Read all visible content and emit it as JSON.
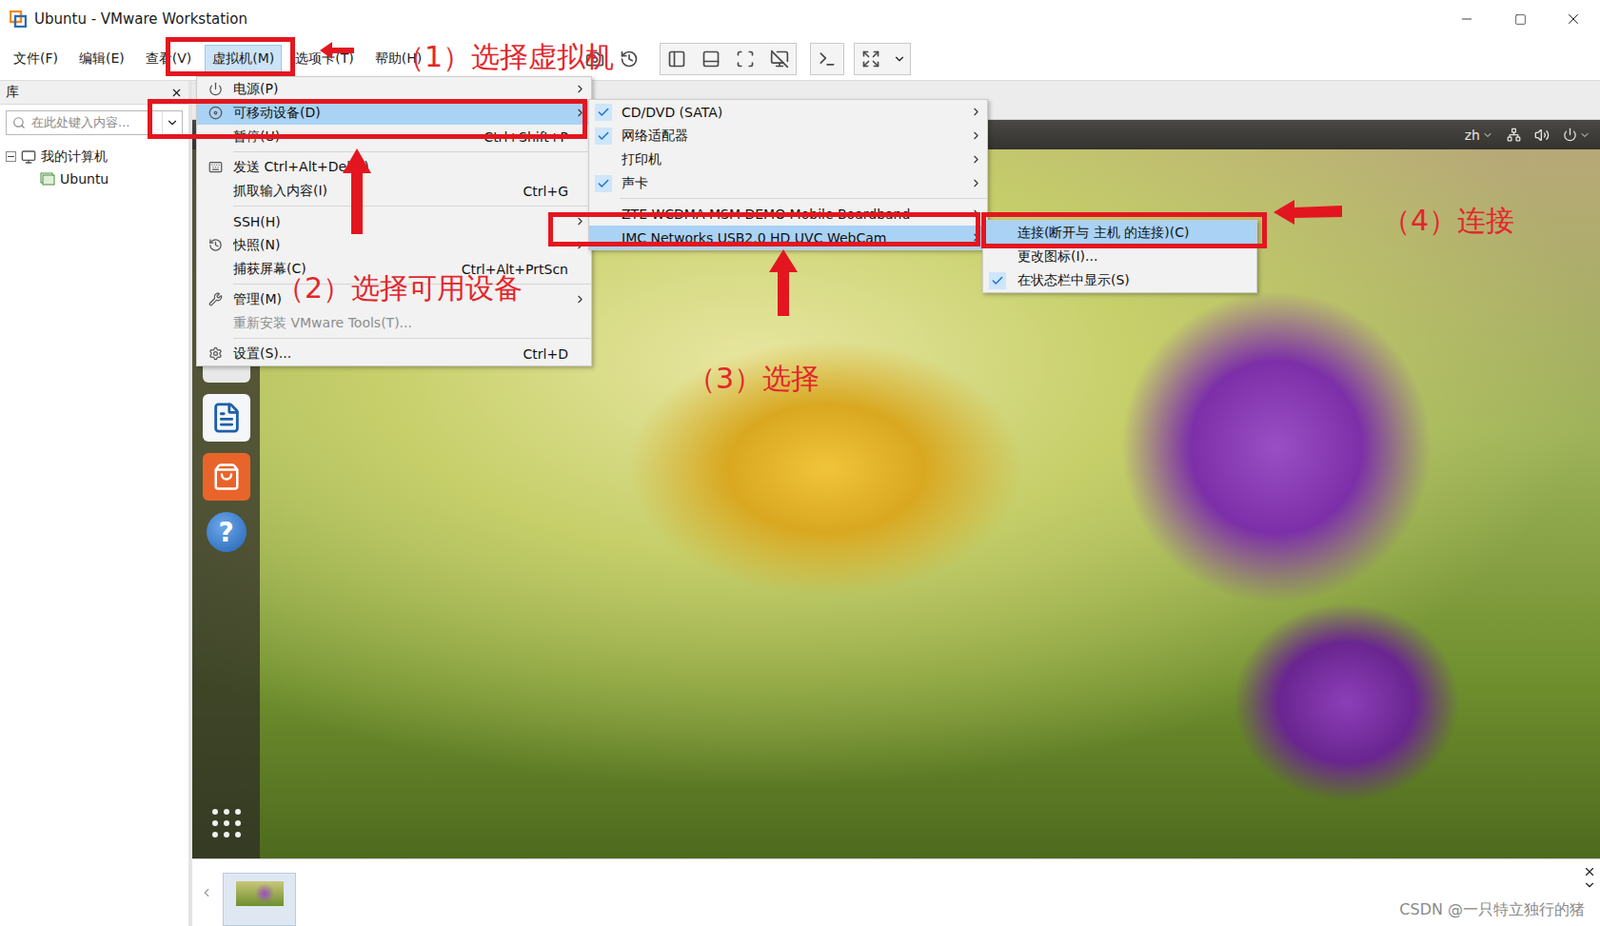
{
  "window": {
    "title": "Ubuntu - VMware Workstation"
  },
  "menubar": [
    {
      "label": "文件(F)",
      "selected": false
    },
    {
      "label": "编辑(E)",
      "selected": false
    },
    {
      "label": "查看(V)",
      "selected": false
    },
    {
      "label": "虚拟机(M)",
      "selected": true
    },
    {
      "label": "选项卡(T)",
      "selected": false
    },
    {
      "label": "帮助(H)",
      "selected": false
    }
  ],
  "library": {
    "title": "库",
    "search_placeholder": "在此处键入内容...",
    "tree": [
      {
        "label": "我的计算机",
        "level": 0,
        "expanded": true,
        "selected": false
      },
      {
        "label": "Ubuntu",
        "level": 1,
        "expanded": false,
        "selected": false
      }
    ]
  },
  "guest_panel": {
    "language": "zh"
  },
  "launcher": {
    "help_label": "?"
  },
  "vm_menu": [
    {
      "label": "电源(P)",
      "shortcut": "",
      "submenu": true,
      "selected": false,
      "disabled": false,
      "separator_before": false
    },
    {
      "label": "可移动设备(D)",
      "shortcut": "",
      "submenu": true,
      "selected": true,
      "disabled": false,
      "separator_before": false
    },
    {
      "label": "暂停(U)",
      "shortcut": "Ctrl+Shift+P",
      "submenu": false,
      "selected": false,
      "disabled": false,
      "separator_before": false
    },
    {
      "label": "发送 Ctrl+Alt+Del(E)",
      "shortcut": "",
      "submenu": false,
      "selected": false,
      "disabled": false,
      "separator_before": true
    },
    {
      "label": "抓取输入内容(I)",
      "shortcut": "Ctrl+G",
      "submenu": false,
      "selected": false,
      "disabled": false,
      "separator_before": false
    },
    {
      "label": "SSH(H)",
      "shortcut": "",
      "submenu": true,
      "selected": false,
      "disabled": false,
      "separator_before": true
    },
    {
      "label": "快照(N)",
      "shortcut": "",
      "submenu": true,
      "selected": false,
      "disabled": false,
      "separator_before": false
    },
    {
      "label": "捕获屏幕(C)",
      "shortcut": "Ctrl+Alt+PrtScn",
      "submenu": false,
      "selected": false,
      "disabled": false,
      "separator_before": false
    },
    {
      "label": "管理(M)",
      "shortcut": "",
      "submenu": true,
      "selected": false,
      "disabled": false,
      "separator_before": true
    },
    {
      "label": "重新安装 VMware Tools(T)...",
      "shortcut": "",
      "submenu": false,
      "selected": false,
      "disabled": true,
      "separator_before": false
    },
    {
      "label": "设置(S)...",
      "shortcut": "Ctrl+D",
      "submenu": false,
      "selected": false,
      "disabled": false,
      "separator_before": true
    }
  ],
  "removable_menu": [
    {
      "label": "CD/DVD (SATA)",
      "checked": true,
      "selected": false,
      "submenu": true,
      "separator_before": false
    },
    {
      "label": "网络适配器",
      "checked": true,
      "selected": false,
      "submenu": true,
      "separator_before": false
    },
    {
      "label": "打印机",
      "checked": false,
      "selected": false,
      "submenu": true,
      "separator_before": false
    },
    {
      "label": "声卡",
      "checked": true,
      "selected": false,
      "submenu": true,
      "separator_before": false
    },
    {
      "label": "ZTE WCDMA MSM DEMO Mobile Boardband",
      "checked": false,
      "selected": false,
      "submenu": true,
      "separator_before": true
    },
    {
      "label": "IMC Networks USB2.0 HD UVC WebCam",
      "checked": false,
      "selected": true,
      "submenu": true,
      "separator_before": false
    }
  ],
  "device_menu": [
    {
      "label": "连接(断开与 主机 的连接)(C)",
      "checked": false,
      "selected": true
    },
    {
      "label": "更改图标(I)...",
      "checked": false,
      "selected": false
    },
    {
      "label": "在状态栏中显示(S)",
      "checked": true,
      "selected": false
    }
  ],
  "annotations": [
    {
      "label": "（1）选择虚拟机"
    },
    {
      "label": "（2）选择可用设备"
    },
    {
      "label": "（3）选择"
    },
    {
      "label": "（4）连接"
    }
  ],
  "watermark": "CSDN @一只特立独行的猪"
}
